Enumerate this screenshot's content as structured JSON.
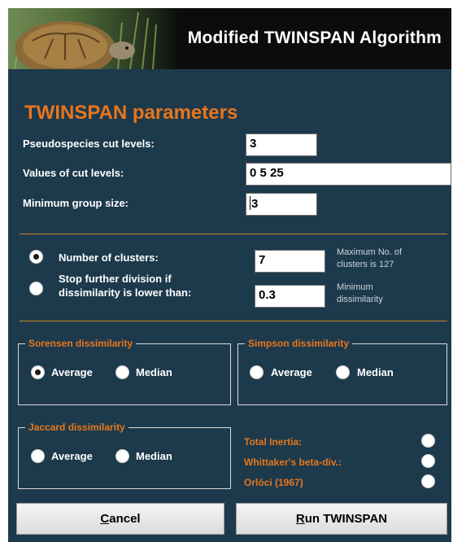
{
  "window": {
    "title": "Modified TWINSPAN Algorithm"
  },
  "heading": "TWINSPAN parameters",
  "params": {
    "pseudospecies_label": "Pseudospecies cut levels:",
    "pseudospecies_value": "3",
    "cut_values_label": "Values of cut levels:",
    "cut_values_value": "0 5 25",
    "min_group_label": "Minimum group size:",
    "min_group_value": "3"
  },
  "stopping": {
    "clusters_label": "Number of clusters:",
    "clusters_value": "7",
    "clusters_hint_line1": "Maximum No. of",
    "clusters_hint_line2": "clusters is 127",
    "clusters_selected": true,
    "dissim_label_line1": "Stop further division if",
    "dissim_label_line2": "dissimilarity is lower than:",
    "dissim_value": "0.3",
    "dissim_hint_line1": "Minimum",
    "dissim_hint_line2": "dissimilarity",
    "dissim_selected": false
  },
  "sorensen": {
    "title": "Sorensen dissimilarity",
    "average": "Average",
    "median": "Median",
    "selected": "average"
  },
  "simpson": {
    "title": "Simpson dissimilarity",
    "average": "Average",
    "median": "Median",
    "selected": "none"
  },
  "jaccard": {
    "title": "Jaccard dissimilarity",
    "average": "Average",
    "median": "Median",
    "selected": "none"
  },
  "measures": {
    "total_inertia": "Total Inertia:",
    "whittaker": "Whittaker's beta-div.:",
    "orloci": "Orlóci (1967)"
  },
  "buttons": {
    "cancel_first": "C",
    "cancel_rest": "ancel",
    "run_first": "R",
    "run_rest": "un TWINSPAN"
  },
  "colors": {
    "background": "#1d3a4c",
    "accent": "#e8761c",
    "rule": "#c8842a"
  }
}
